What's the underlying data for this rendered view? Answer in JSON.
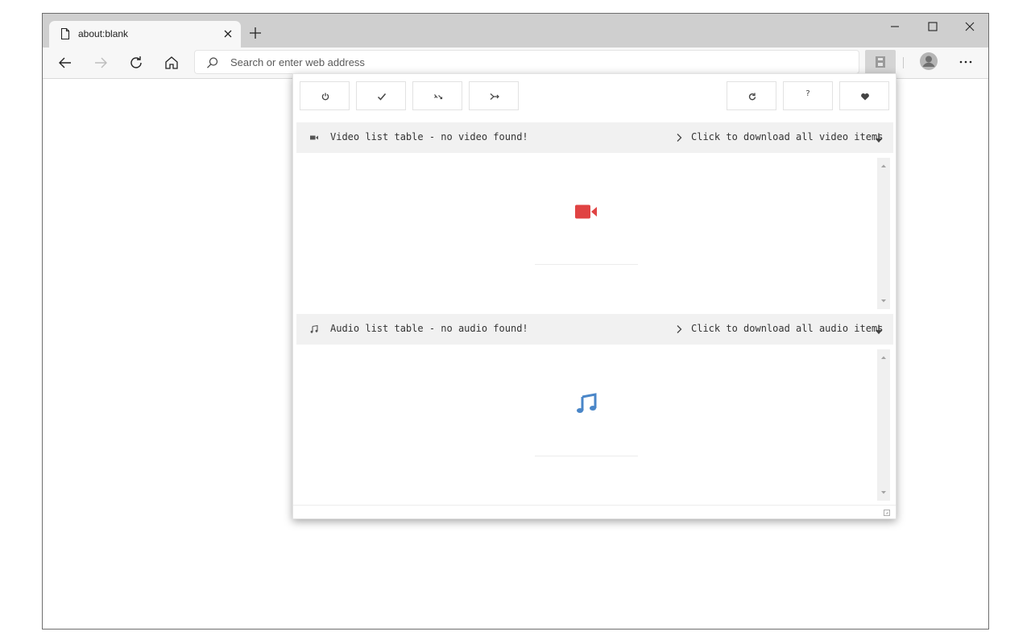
{
  "browser": {
    "tab_title": "about:blank",
    "address_placeholder": "Search or enter web address"
  },
  "icons": {
    "tab_page": "page-icon",
    "tab_close": "close-icon",
    "new_tab": "plus-icon",
    "minimize": "minimize-icon",
    "maximize": "maximize-icon",
    "close_window": "close-icon",
    "back": "arrow-left-icon",
    "forward": "arrow-right-icon",
    "refresh": "refresh-icon",
    "home": "home-icon",
    "search": "search-icon",
    "extension": "extension-icon",
    "profile": "profile-icon",
    "more": "ellipsis-icon"
  },
  "popup": {
    "toolbar_buttons": [
      {
        "name": "power-button",
        "icon": "power-icon"
      },
      {
        "name": "check-button",
        "icon": "check-icon"
      },
      {
        "name": "shuffle-button",
        "icon": "shuffle-icon"
      },
      {
        "name": "merge-button",
        "icon": "merge-icon"
      },
      {
        "name": "reload-button",
        "icon": "reload-icon"
      },
      {
        "name": "help-button",
        "label": "?"
      },
      {
        "name": "favorite-button",
        "icon": "heart-icon"
      }
    ],
    "help_label": "?",
    "video": {
      "header": "Video list table - no video found!",
      "download_all": "Click to download all video items",
      "icon": "video-camera-icon",
      "color": "#e04343"
    },
    "audio": {
      "header": "Audio list table - no audio found!",
      "download_all": "Click to download all audio items",
      "icon": "music-note-icon",
      "color": "#4a86c8"
    }
  }
}
